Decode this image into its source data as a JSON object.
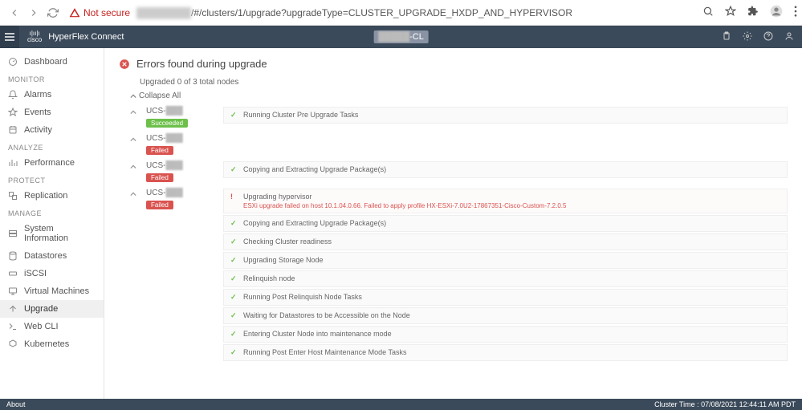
{
  "browser": {
    "security": "Not secure",
    "url_suffix": "/#/clusters/1/upgrade?upgradeType=CLUSTER_UPGRADE_HXDP_AND_HYPERVISOR"
  },
  "header": {
    "brand": "HyperFlex Connect",
    "cluster": "-CL"
  },
  "sidebar": {
    "dashboard": "Dashboard",
    "monitor_head": "MONITOR",
    "alarms": "Alarms",
    "events": "Events",
    "activity": "Activity",
    "analyze_head": "ANALYZE",
    "performance": "Performance",
    "protect_head": "PROTECT",
    "replication": "Replication",
    "manage_head": "MANAGE",
    "sysinfo": "System Information",
    "datastores": "Datastores",
    "iscsi": "iSCSI",
    "vms": "Virtual Machines",
    "upgrade": "Upgrade",
    "webcli": "Web CLI",
    "kubernetes": "Kubernetes"
  },
  "content": {
    "title": "Errors found during upgrade",
    "progress": "Upgraded 0 of 3 total nodes",
    "collapse": "Collapse All",
    "badges": {
      "succ": "Succeeded",
      "fail": "Failed"
    },
    "nodes": [
      {
        "name": "UCS-",
        "status": "succ",
        "tasks": [
          {
            "ok": true,
            "text": "Running Cluster Pre Upgrade Tasks"
          }
        ]
      },
      {
        "name": "UCS-",
        "status": "fail",
        "tasks": []
      },
      {
        "name": "UCS-",
        "status": "fail",
        "tasks": [
          {
            "ok": true,
            "text": "Copying and Extracting Upgrade Package(s)"
          }
        ]
      },
      {
        "name": "UCS-",
        "status": "fail",
        "tasks": [
          {
            "ok": false,
            "text": "Upgrading hypervisor",
            "detail": "ESXi upgrade failed on host 10.1.04.0.66. Failed to apply profile HX-ESXi-7.0U2-17867351-Cisco-Custom-7.2.0.5"
          },
          {
            "ok": true,
            "text": "Copying and Extracting Upgrade Package(s)"
          },
          {
            "ok": true,
            "text": "Checking Cluster readiness"
          },
          {
            "ok": true,
            "text": "Upgrading Storage Node"
          },
          {
            "ok": true,
            "text": "Relinquish node"
          },
          {
            "ok": true,
            "text": "Running Post Relinquish Node Tasks"
          },
          {
            "ok": true,
            "text": "Waiting for Datastores to be Accessible on the Node"
          },
          {
            "ok": true,
            "text": "Entering Cluster Node into maintenance mode"
          },
          {
            "ok": true,
            "text": "Running Post Enter Host Maintenance Mode Tasks"
          }
        ]
      }
    ]
  },
  "status": {
    "about": "About",
    "time": "Cluster Time : 07/08/2021 12:44:11 AM PDT"
  }
}
